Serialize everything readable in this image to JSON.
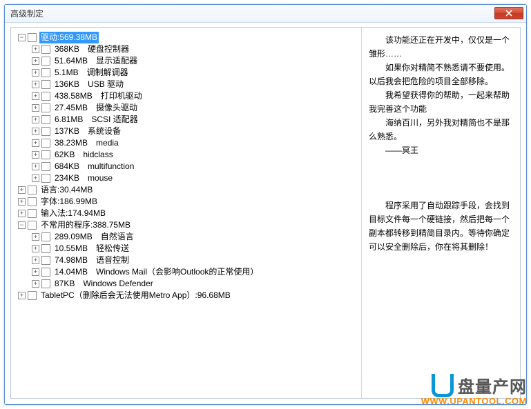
{
  "window": {
    "title": "高级制定"
  },
  "tree": {
    "root": [
      {
        "label": "驱动:569.38MB",
        "selected": true,
        "expanded": true,
        "children": [
          {
            "size": "368KB",
            "name": "硬盘控制器"
          },
          {
            "size": "51.64MB",
            "name": "显示适配器"
          },
          {
            "size": "5.1MB",
            "name": "调制解调器"
          },
          {
            "size": "136KB",
            "name": "USB 驱动"
          },
          {
            "size": "438.58MB",
            "name": "打印机驱动"
          },
          {
            "size": "27.45MB",
            "name": "摄像头驱动"
          },
          {
            "size": "6.81MB",
            "name": "SCSI 适配器"
          },
          {
            "size": "137KB",
            "name": "系统设备"
          },
          {
            "size": "38.23MB",
            "name": "media"
          },
          {
            "size": "62KB",
            "name": "hidclass"
          },
          {
            "size": "684KB",
            "name": "multifunction"
          },
          {
            "size": "234KB",
            "name": "mouse"
          }
        ]
      },
      {
        "label": "语言:30.44MB"
      },
      {
        "label": "字体:186.99MB"
      },
      {
        "label": "输入法:174.94MB"
      },
      {
        "label": "不常用的程序:388.75MB",
        "expanded": true,
        "children": [
          {
            "size": "289.09MB",
            "name": "自然语言"
          },
          {
            "size": "10.55MB",
            "name": "轻松传送"
          },
          {
            "size": "74.98MB",
            "name": "语音控制"
          },
          {
            "size": "14.04MB",
            "name": "Windows Mail（会影响Outlook的正常使用）"
          },
          {
            "size": "87KB",
            "name": "Windows Defender"
          }
        ]
      },
      {
        "label": "TabletPC（删除后会无法使用Metro App）:96.68MB"
      }
    ]
  },
  "side": {
    "block1": [
      "该功能还正在开发中，仅仅是一个雏形……",
      "如果你对精简不熟悉请不要使用。以后我会把危险的项目全部移除。",
      "我希望获得你的帮助，一起来帮助我完善这个功能",
      "海纳百川，另外我对精简也不是那么熟悉。",
      "——冥王"
    ],
    "block2": "程序采用了自动跟踪手段，会找到目标文件每一个硬链接，然后把每一个副本都转移到精简目录内。等待你确定可以安全删除后，你在将其删除！"
  },
  "watermark": {
    "brand": "盘量产网",
    "url": "WWW.UPANTOOL.COM"
  }
}
